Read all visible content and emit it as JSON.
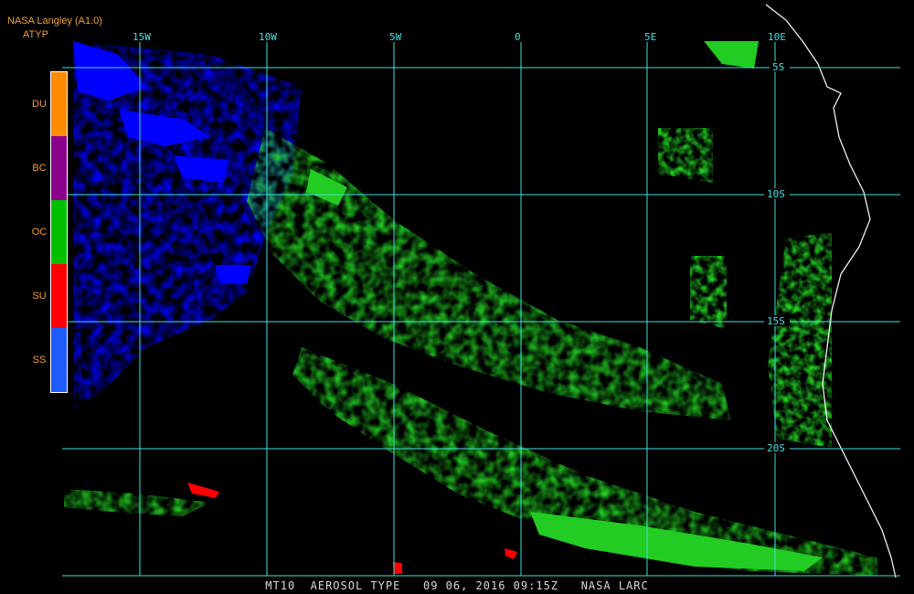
{
  "header": {
    "source": "NASA Langley (A1.0)",
    "product": "ATYP"
  },
  "legend": [
    {
      "code": "DU",
      "color": "#ff8c00"
    },
    {
      "code": "BC",
      "color": "#8b008b"
    },
    {
      "code": "OC",
      "color": "#00c000"
    },
    {
      "code": "SU",
      "color": "#ff0000"
    },
    {
      "code": "SS",
      "color": "#1e5cff"
    }
  ],
  "longitude_labels": [
    "15W",
    "10W",
    "5W",
    "0",
    "5E",
    "10E"
  ],
  "latitude_labels": [
    "5S",
    "10S",
    "15S",
    "20S"
  ],
  "footer": "MT10  AEROSOL TYPE   09 06, 2016 09:15Z   NASA LARC",
  "colors": {
    "grid": "#40e0e0",
    "coast": "#ffffff",
    "blue_aerosol": "#0000ff",
    "green_aerosol": "#22cc22",
    "red_aerosol": "#ff0000"
  }
}
